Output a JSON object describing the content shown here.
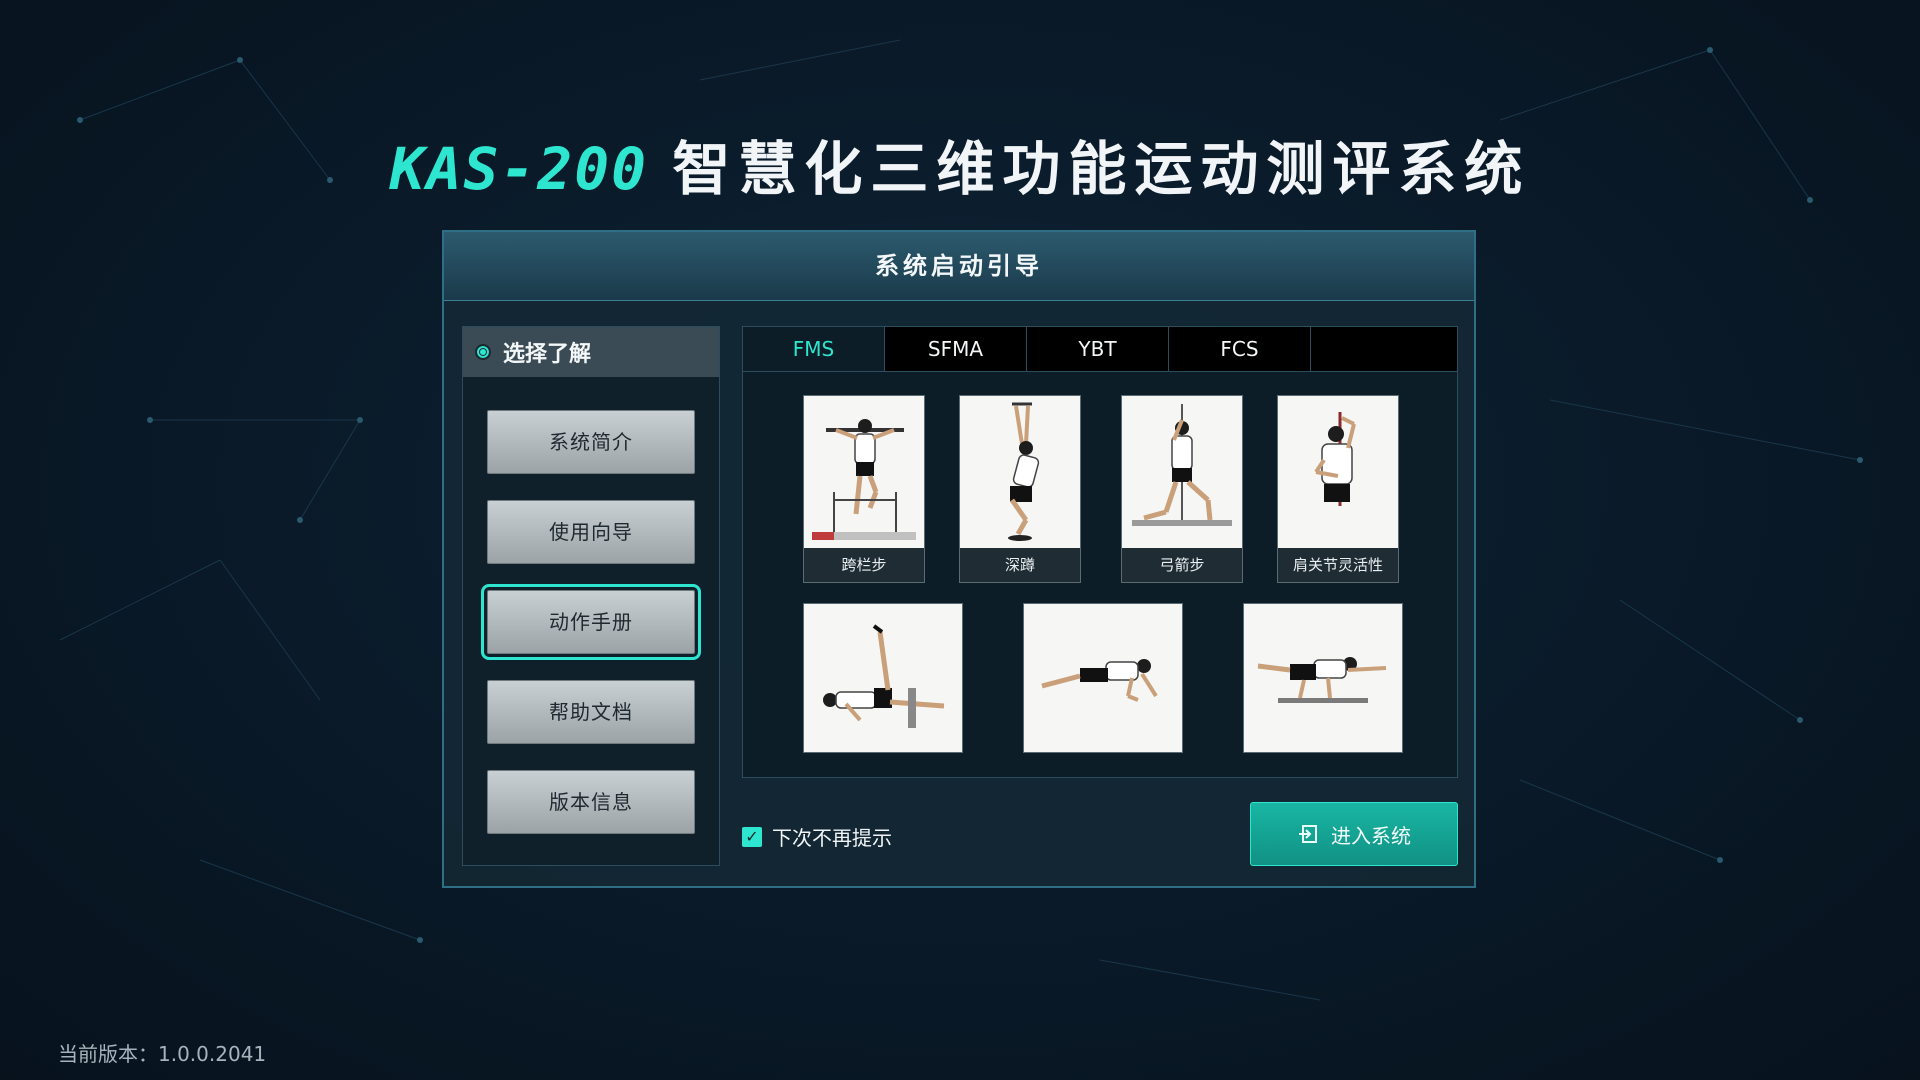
{
  "app": {
    "title_model": "KAS-200",
    "title_name": "智慧化三维功能运动测评系统"
  },
  "dialog": {
    "title": "系统启动引导"
  },
  "nav": {
    "header": "选择了解",
    "items": [
      {
        "label": "系统简介"
      },
      {
        "label": "使用向导"
      },
      {
        "label": "动作手册",
        "active": true
      },
      {
        "label": "帮助文档"
      },
      {
        "label": "版本信息"
      }
    ]
  },
  "tabs": [
    {
      "label": "FMS",
      "active": true
    },
    {
      "label": "SFMA"
    },
    {
      "label": "YBT"
    },
    {
      "label": "FCS"
    }
  ],
  "cards": {
    "row1": [
      {
        "label": "跨栏步",
        "icon": "hurdle-step-icon"
      },
      {
        "label": "深蹲",
        "icon": "deep-squat-icon"
      },
      {
        "label": "弓箭步",
        "icon": "lunge-icon"
      },
      {
        "label": "肩关节灵活性",
        "icon": "shoulder-mobility-icon"
      }
    ],
    "row2": [
      {
        "icon": "leg-raise-icon"
      },
      {
        "icon": "push-up-icon"
      },
      {
        "icon": "rotary-stability-icon"
      }
    ]
  },
  "footer": {
    "dont_remind_label": "下次不再提示",
    "dont_remind_checked": true,
    "enter_button_label": "进入系统"
  },
  "version": {
    "text": "当前版本：1.0.0.2041"
  },
  "colors": {
    "accent": "#2ee6cf",
    "background": "#0a1b2a",
    "button_gray": "#b5bcc0",
    "enter_button": "#16a897"
  }
}
